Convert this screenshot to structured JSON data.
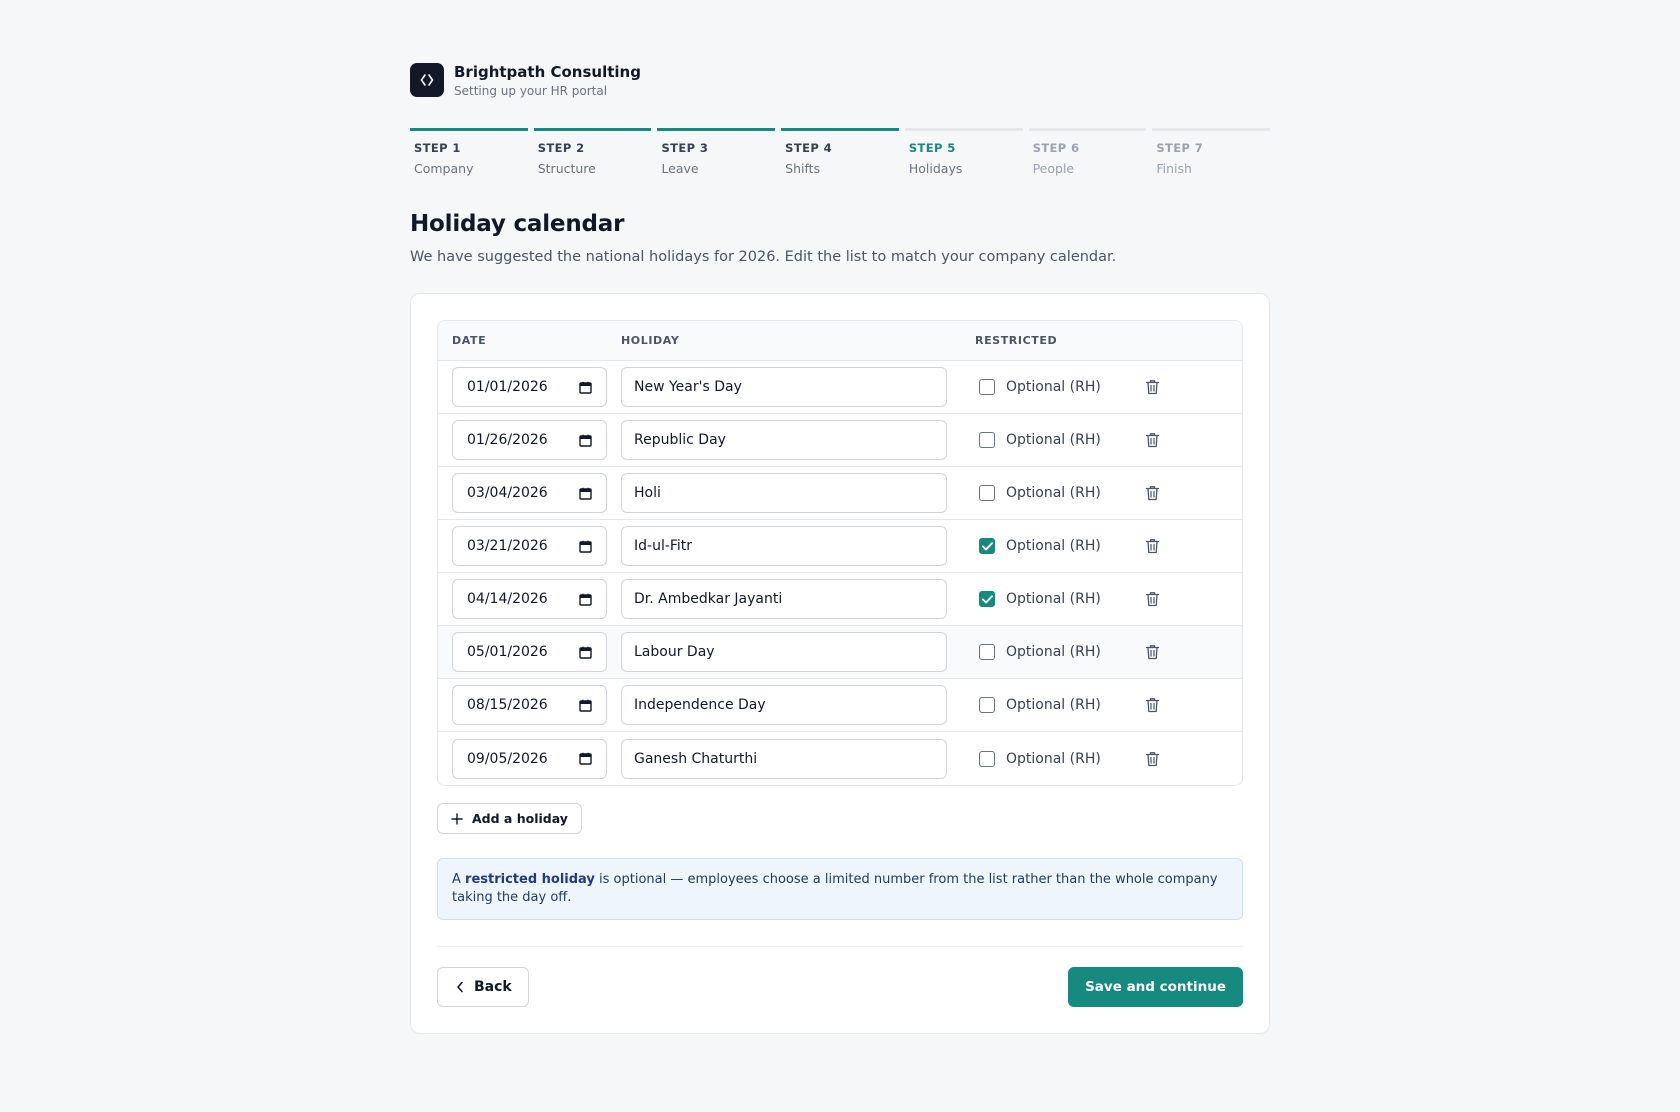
{
  "brand": {
    "name": "Brightpath Consulting",
    "subtitle": "Setting up your HR portal"
  },
  "steps": [
    {
      "num": "STEP 1",
      "name": "Company",
      "state": "done"
    },
    {
      "num": "STEP 2",
      "name": "Structure",
      "state": "done"
    },
    {
      "num": "STEP 3",
      "name": "Leave",
      "state": "done"
    },
    {
      "num": "STEP 4",
      "name": "Shifts",
      "state": "done"
    },
    {
      "num": "STEP 5",
      "name": "Holidays",
      "state": "current"
    },
    {
      "num": "STEP 6",
      "name": "People",
      "state": "todo"
    },
    {
      "num": "STEP 7",
      "name": "Finish",
      "state": "todo"
    }
  ],
  "page": {
    "title": "Holiday calendar",
    "description": "We have suggested the national holidays for 2026. Edit the list to match your company calendar."
  },
  "table": {
    "headers": {
      "date": "DATE",
      "holiday": "HOLIDAY",
      "restricted": "RESTRICTED"
    },
    "optional_label": "Optional (RH)",
    "rows": [
      {
        "date": "01/01/2026",
        "name": "New Year's Day",
        "restricted": false
      },
      {
        "date": "01/26/2026",
        "name": "Republic Day",
        "restricted": false
      },
      {
        "date": "03/04/2026",
        "name": "Holi",
        "restricted": false
      },
      {
        "date": "03/21/2026",
        "name": "Id-ul-Fitr",
        "restricted": true
      },
      {
        "date": "04/14/2026",
        "name": "Dr. Ambedkar Jayanti",
        "restricted": true
      },
      {
        "date": "05/01/2026",
        "name": "Labour Day",
        "restricted": false
      },
      {
        "date": "08/15/2026",
        "name": "Independence Day",
        "restricted": false
      },
      {
        "date": "09/05/2026",
        "name": "Ganesh Chaturthi",
        "restricted": false
      }
    ]
  },
  "add_button": "Add a holiday",
  "note": {
    "prefix": "A ",
    "term": "restricted holiday",
    "text": " is optional — employees choose a limited number from the list rather than the whole company taking the day off."
  },
  "footer": {
    "back": "Back",
    "save": "Save and continue"
  },
  "colors": {
    "accent": "#168a7e",
    "note_bg": "#eef5fc",
    "logo_bg": "#111827"
  },
  "icons": {
    "logo": "code-brackets-icon",
    "date_picker": "calendar-icon",
    "delete": "trash-icon",
    "add": "plus-icon",
    "back": "chevron-left-icon"
  }
}
